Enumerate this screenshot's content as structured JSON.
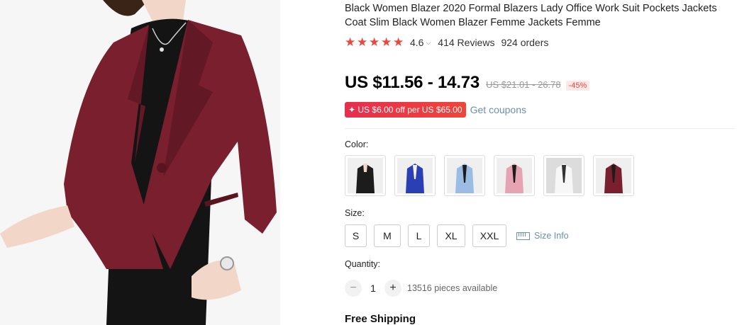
{
  "product": {
    "title": "Black Women Blazer 2020 Formal Blazers Lady Office Work Suit Pockets Jackets Coat Slim Black Women Blazer Femme Jackets Femme",
    "rating": "4.6",
    "reviews": "414 Reviews",
    "orders": "924 orders",
    "rating_fraction": 0.92
  },
  "price": {
    "current": "US $11.56 - 14.73",
    "original": "US $21.01 - 26.78",
    "discount": "-45%"
  },
  "coupon": {
    "badge": "✦ US $6.00 off per US $65.00",
    "link": "Get coupons"
  },
  "color": {
    "label": "Color:",
    "options": [
      {
        "name": "black-blazer",
        "color": "#1c1c1c"
      },
      {
        "name": "blue-blazer",
        "color": "#2b3fb5"
      },
      {
        "name": "light-blue-blazer",
        "color": "#9cbde3"
      },
      {
        "name": "pink-blazer",
        "color": "#e6a3b2"
      },
      {
        "name": "white-blazer",
        "color": "#eeeeee"
      },
      {
        "name": "burgundy-blazer",
        "color": "#7a1f2e"
      }
    ]
  },
  "size": {
    "label": "Size:",
    "options": [
      "S",
      "M",
      "L",
      "XL",
      "XXL"
    ],
    "info": "Size Info"
  },
  "quantity": {
    "label": "Quantity:",
    "value": "1",
    "minus": "−",
    "plus": "+",
    "available": "13516 pieces available"
  },
  "shipping": {
    "label": "Free Shipping"
  },
  "colors": {
    "accent": "#f0453a",
    "link": "#6d8fb0",
    "blazer": "#7a1f2e"
  },
  "icons": {
    "star": "★",
    "chevron": "chevron-down-icon",
    "ruler": "ruler-icon"
  }
}
